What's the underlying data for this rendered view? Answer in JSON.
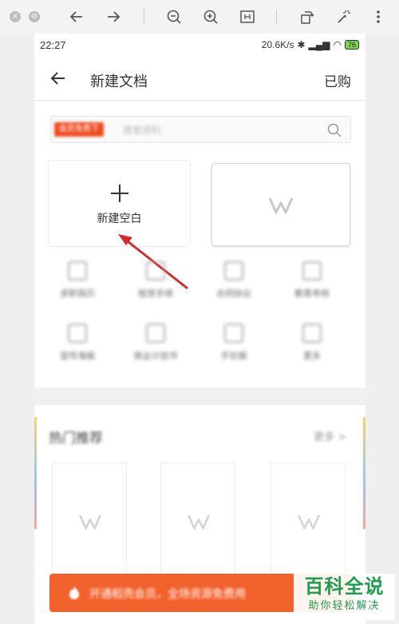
{
  "status_bar": {
    "time": "22:27",
    "network_speed": "20.6K/s",
    "battery": "76"
  },
  "header": {
    "title": "新建文档",
    "purchased_label": "已购"
  },
  "search": {
    "tag": "会员免费下",
    "placeholder": "搜索资料"
  },
  "new_blank": {
    "label": "新建空白"
  },
  "template_grid": [
    {
      "label": "求职简历"
    },
    {
      "label": "租赁手续"
    },
    {
      "label": "合同协议"
    },
    {
      "label": "教育考核"
    },
    {
      "label": "宣传海报"
    },
    {
      "label": "商业计划书"
    },
    {
      "label": "手抄报"
    },
    {
      "label": "更多"
    }
  ],
  "hot_section": {
    "title": "热门推荐",
    "more_label": "更多 >"
  },
  "cta": {
    "text": "开通稻壳会员，全场资源免费用"
  },
  "watermark": {
    "main": "百科全说",
    "sub": "助你轻松解决"
  },
  "colors": {
    "accent": "#f04e23",
    "watermark_green": "#1f9d4e"
  },
  "icons": [
    "back-arrow-icon",
    "search-icon",
    "plus-icon",
    "wps-logo-icon"
  ]
}
